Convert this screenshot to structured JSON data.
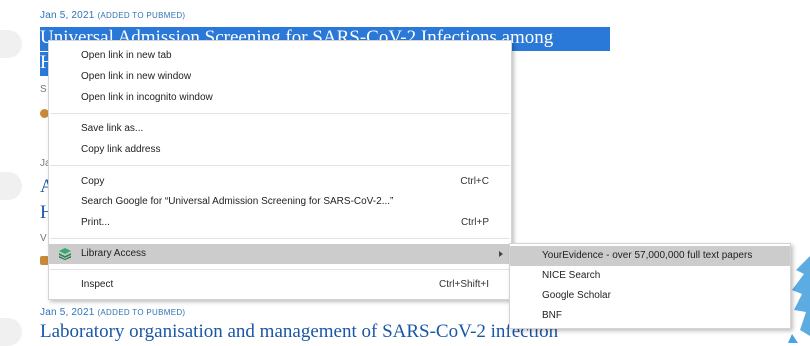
{
  "articles": [
    {
      "date": "Jan 5, 2021",
      "added": "(Added to PubMed)",
      "title": "Universal Admission Screening for SARS-CoV-2 Infections among",
      "title_cont": "H",
      "author_initial": "S"
    },
    {
      "date_initial": "Ja",
      "title_initial": "A",
      "title_cont": "H",
      "author_initial": "V"
    },
    {
      "date": "Jan 5, 2021",
      "added": "(Added to PubMed)",
      "title": "Laboratory organisation and management of SARS-CoV-2 infection"
    }
  ],
  "context_menu": {
    "items": [
      {
        "label": "Open link in new tab"
      },
      {
        "label": "Open link in new window"
      },
      {
        "label": "Open link in incognito window"
      },
      {
        "label": "Save link as..."
      },
      {
        "label": "Copy link address"
      },
      {
        "label": "Copy",
        "shortcut": "Ctrl+C"
      },
      {
        "label": "Search Google for “Universal Admission Screening for SARS-CoV-2...”"
      },
      {
        "label": "Print...",
        "shortcut": "Ctrl+P"
      },
      {
        "label": "Library Access",
        "icon": "library-access-icon"
      },
      {
        "label": "Inspect",
        "shortcut": "Ctrl+Shift+I"
      }
    ]
  },
  "submenu": {
    "items": [
      {
        "label": "YourEvidence - over 57,000,000 full text papers"
      },
      {
        "label": "NICE Search"
      },
      {
        "label": "Google Scholar"
      },
      {
        "label": "BNF"
      }
    ]
  },
  "colors": {
    "link": "#1a56a8",
    "selection": "#2a78d8",
    "menu_highlight": "#cccccc",
    "library_icon": "#2e8b57"
  }
}
